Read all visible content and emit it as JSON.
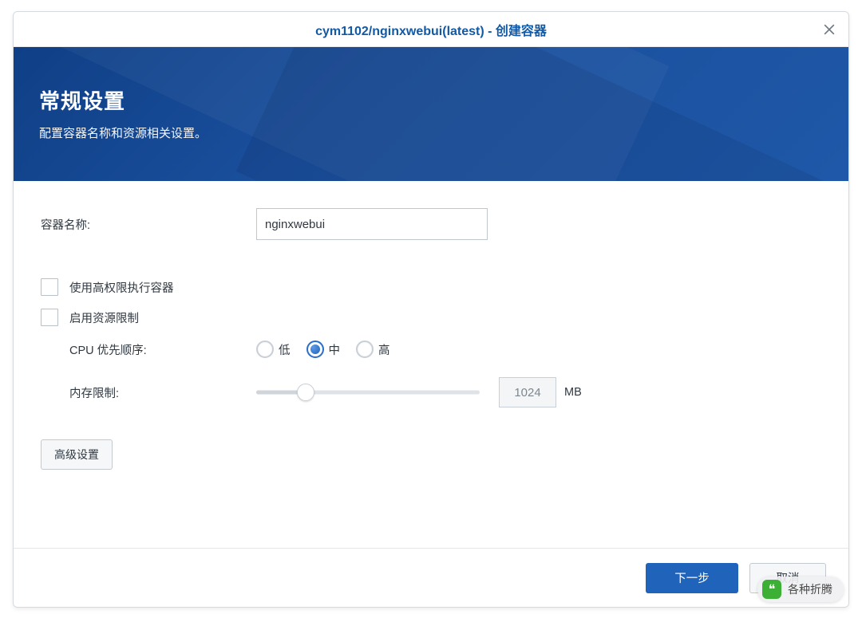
{
  "title": "cym1102/nginxwebui(latest) - 创建容器",
  "hero": {
    "heading": "常规设置",
    "subheading": "配置容器名称和资源相关设置。"
  },
  "form": {
    "container_name_label": "容器名称:",
    "container_name_value": "nginxwebui",
    "privileged_label": "使用高权限执行容器",
    "resource_limit_label": "启用资源限制",
    "cpu_priority_label": "CPU 优先顺序:",
    "cpu_options": {
      "low": "低",
      "mid": "中",
      "high": "高"
    },
    "memory_limit_label": "内存限制:",
    "memory_value": "1024",
    "memory_unit": "MB",
    "advanced_button": "高级设置"
  },
  "footer": {
    "next": "下一步",
    "cancel": "取消"
  },
  "watermark": "各种折腾"
}
